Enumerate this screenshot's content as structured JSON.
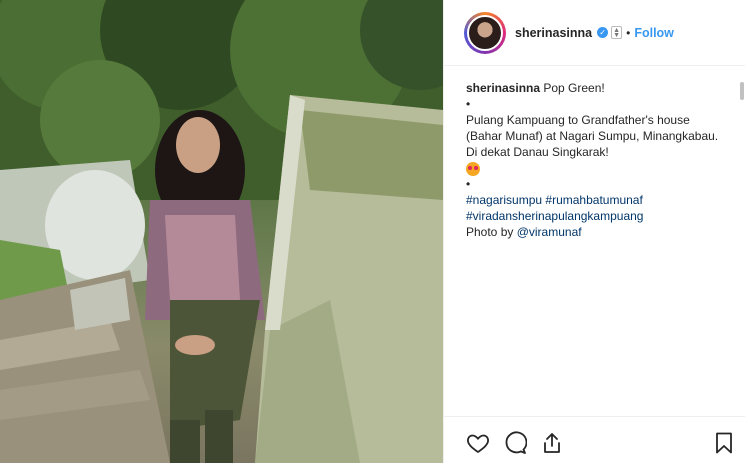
{
  "post": {
    "username": "sherinasinna",
    "follow_label": "Follow",
    "dot": "•"
  },
  "caption": {
    "username": "sherinasinna",
    "text": " Pop Green!",
    "bullet1": "•",
    "body": "Pulang Kampuang to Grandfather's house (Bahar Munaf) at Nagari Sumpu, Minangkabau. Di dekat Danau Singkarak!",
    "bullet2": "•",
    "hashtag1": "#nagarisumpu",
    "hashtag2": "#rumahbatumunaf",
    "hashtag3": "#viradansherinapulangkampuang",
    "photo_by": "Photo by ",
    "mention": "@viramunaf"
  },
  "icons": {
    "verified": "verified-badge-icon",
    "like": "heart-icon",
    "comment": "comment-icon",
    "share": "share-icon",
    "save": "bookmark-icon"
  },
  "colors": {
    "link": "#3897f0",
    "hashtag": "#003569",
    "text": "#262626"
  }
}
